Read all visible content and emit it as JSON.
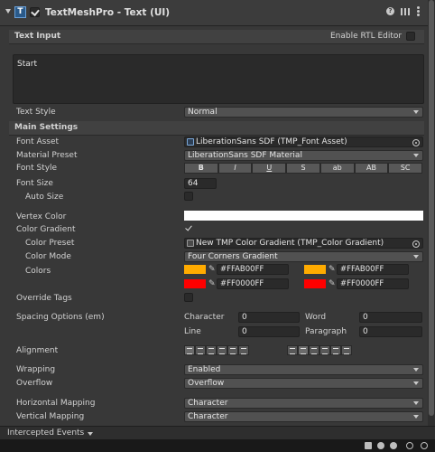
{
  "header": {
    "component_title": "TextMeshPro - Text (UI)",
    "enabled": true
  },
  "text_input": {
    "section_label": "Text Input",
    "rtl_label": "Enable RTL Editor",
    "text_value": "Start"
  },
  "text_style": {
    "label": "Text Style",
    "value": "Normal"
  },
  "main_settings": {
    "section_label": "Main Settings",
    "font_asset_label": "Font Asset",
    "font_asset_value": "LiberationSans SDF (TMP_Font Asset)",
    "material_preset_label": "Material Preset",
    "material_preset_value": "LiberationSans SDF Material",
    "font_style_label": "Font Style",
    "font_style_buttons": [
      "B",
      "I",
      "U",
      "S",
      "ab",
      "AB",
      "SC"
    ],
    "font_size_label": "Font Size",
    "font_size_value": "64",
    "auto_size_label": "Auto Size",
    "vertex_color_label": "Vertex Color",
    "vertex_color": "#FFFFFF",
    "color_gradient_label": "Color Gradient",
    "color_gradient_checked": true,
    "color_preset_label": "Color Preset",
    "color_preset_value": "New TMP Color Gradient (TMP_Color Gradient)",
    "color_mode_label": "Color Mode",
    "color_mode_value": "Four Corners Gradient",
    "colors_label": "Colors",
    "colors": [
      {
        "hex": "#FFAB00FF",
        "swatch": "#FFAB00"
      },
      {
        "hex": "#FFAB00FF",
        "swatch": "#FFAB00"
      },
      {
        "hex": "#FF0000FF",
        "swatch": "#FF0000"
      },
      {
        "hex": "#FF0000FF",
        "swatch": "#FF0000"
      }
    ],
    "override_tags_label": "Override Tags",
    "spacing_label": "Spacing Options (em)",
    "spacing": {
      "character_label": "Character",
      "character_value": "0",
      "word_label": "Word",
      "word_value": "0",
      "line_label": "Line",
      "line_value": "0",
      "paragraph_label": "Paragraph",
      "paragraph_value": "0"
    },
    "alignment_label": "Alignment",
    "wrapping_label": "Wrapping",
    "wrapping_value": "Enabled",
    "overflow_label": "Overflow",
    "overflow_value": "Overflow",
    "horizontal_mapping_label": "Horizontal Mapping",
    "horizontal_mapping_value": "Character",
    "vertical_mapping_label": "Vertical Mapping",
    "vertical_mapping_value": "Character"
  },
  "footer": {
    "intercepted_events_label": "Intercepted Events"
  },
  "colors": {
    "panel_bg": "#383838",
    "header_bg": "#3c3c3c",
    "accent_orange": "#FFAB00",
    "accent_red": "#FF0000"
  }
}
